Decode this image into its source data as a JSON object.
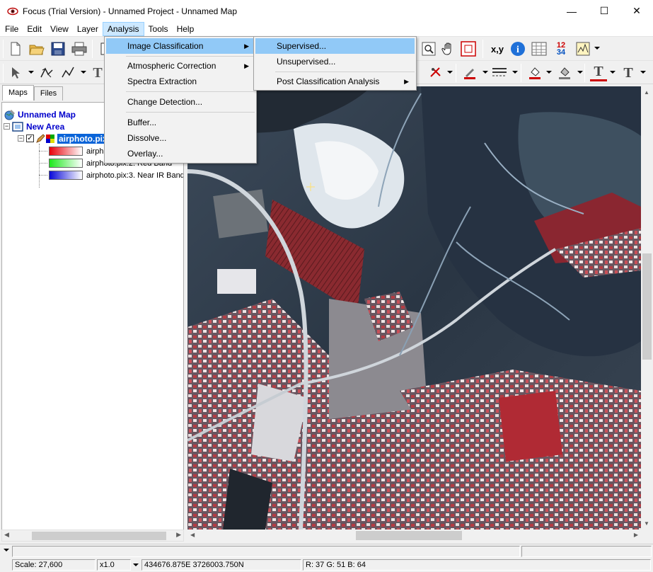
{
  "window": {
    "title": "Focus (Trial Version) - Unnamed Project - Unnamed Map",
    "minimize": "—",
    "maximize": "☐",
    "close": "✕"
  },
  "menubar": {
    "items": [
      "File",
      "Edit",
      "View",
      "Layer",
      "Analysis",
      "Tools",
      "Help"
    ],
    "active": "Analysis"
  },
  "analysis_menu": {
    "items": [
      {
        "label": "Image Classification",
        "submenu": true,
        "highlighted": true
      },
      {
        "label": "Atmospheric Correction",
        "submenu": true
      },
      {
        "label": "Spectra Extraction",
        "submenu": false
      },
      {
        "label": "Change Detection...",
        "submenu": false
      },
      {
        "label": "Buffer...",
        "submenu": false
      },
      {
        "label": "Dissolve...",
        "submenu": false
      },
      {
        "label": "Overlay...",
        "submenu": false
      }
    ]
  },
  "classification_submenu": {
    "items": [
      {
        "label": "Supervised...",
        "highlighted": true
      },
      {
        "label": "Unsupervised..."
      },
      {
        "label": "Post Classification Analysis",
        "submenu": true
      }
    ]
  },
  "toolbar": {
    "xy_label": "x,y",
    "info_label": "i",
    "numbers_label_top": "12",
    "numbers_label_bottom": "34",
    "text_tool": "T"
  },
  "left_panel": {
    "tabs": [
      "Maps",
      "Files"
    ],
    "selected_tab": "Maps",
    "tree": {
      "map": "Unnamed Map",
      "area": "New Area",
      "layer": "airphoto.pix",
      "bands": [
        {
          "label": "airphoto.pix:1. Green Band",
          "shown": "airphoto.pix:1.",
          "color": "#e8000a"
        },
        {
          "label": "airphoto.pix:2. Red Band",
          "shown": "airphoto.pix:2. Red Band",
          "color": "#1ee81e"
        },
        {
          "label": "airphoto.pix:3. Near IR Band",
          "shown": "airphoto.pix:3. Near IR Band",
          "color": "#0a0ad8"
        }
      ]
    }
  },
  "statusbar": {
    "scale": "Scale: 27,600",
    "zoom": "x1.0",
    "coords": "434676.875E 3726003.750N",
    "rgb": "R: 37 G: 51 B: 64"
  },
  "colors": {
    "menu_highlight": "#91c9f7",
    "tree_selection": "#0a64d8",
    "tree_text": "#0000cc"
  }
}
